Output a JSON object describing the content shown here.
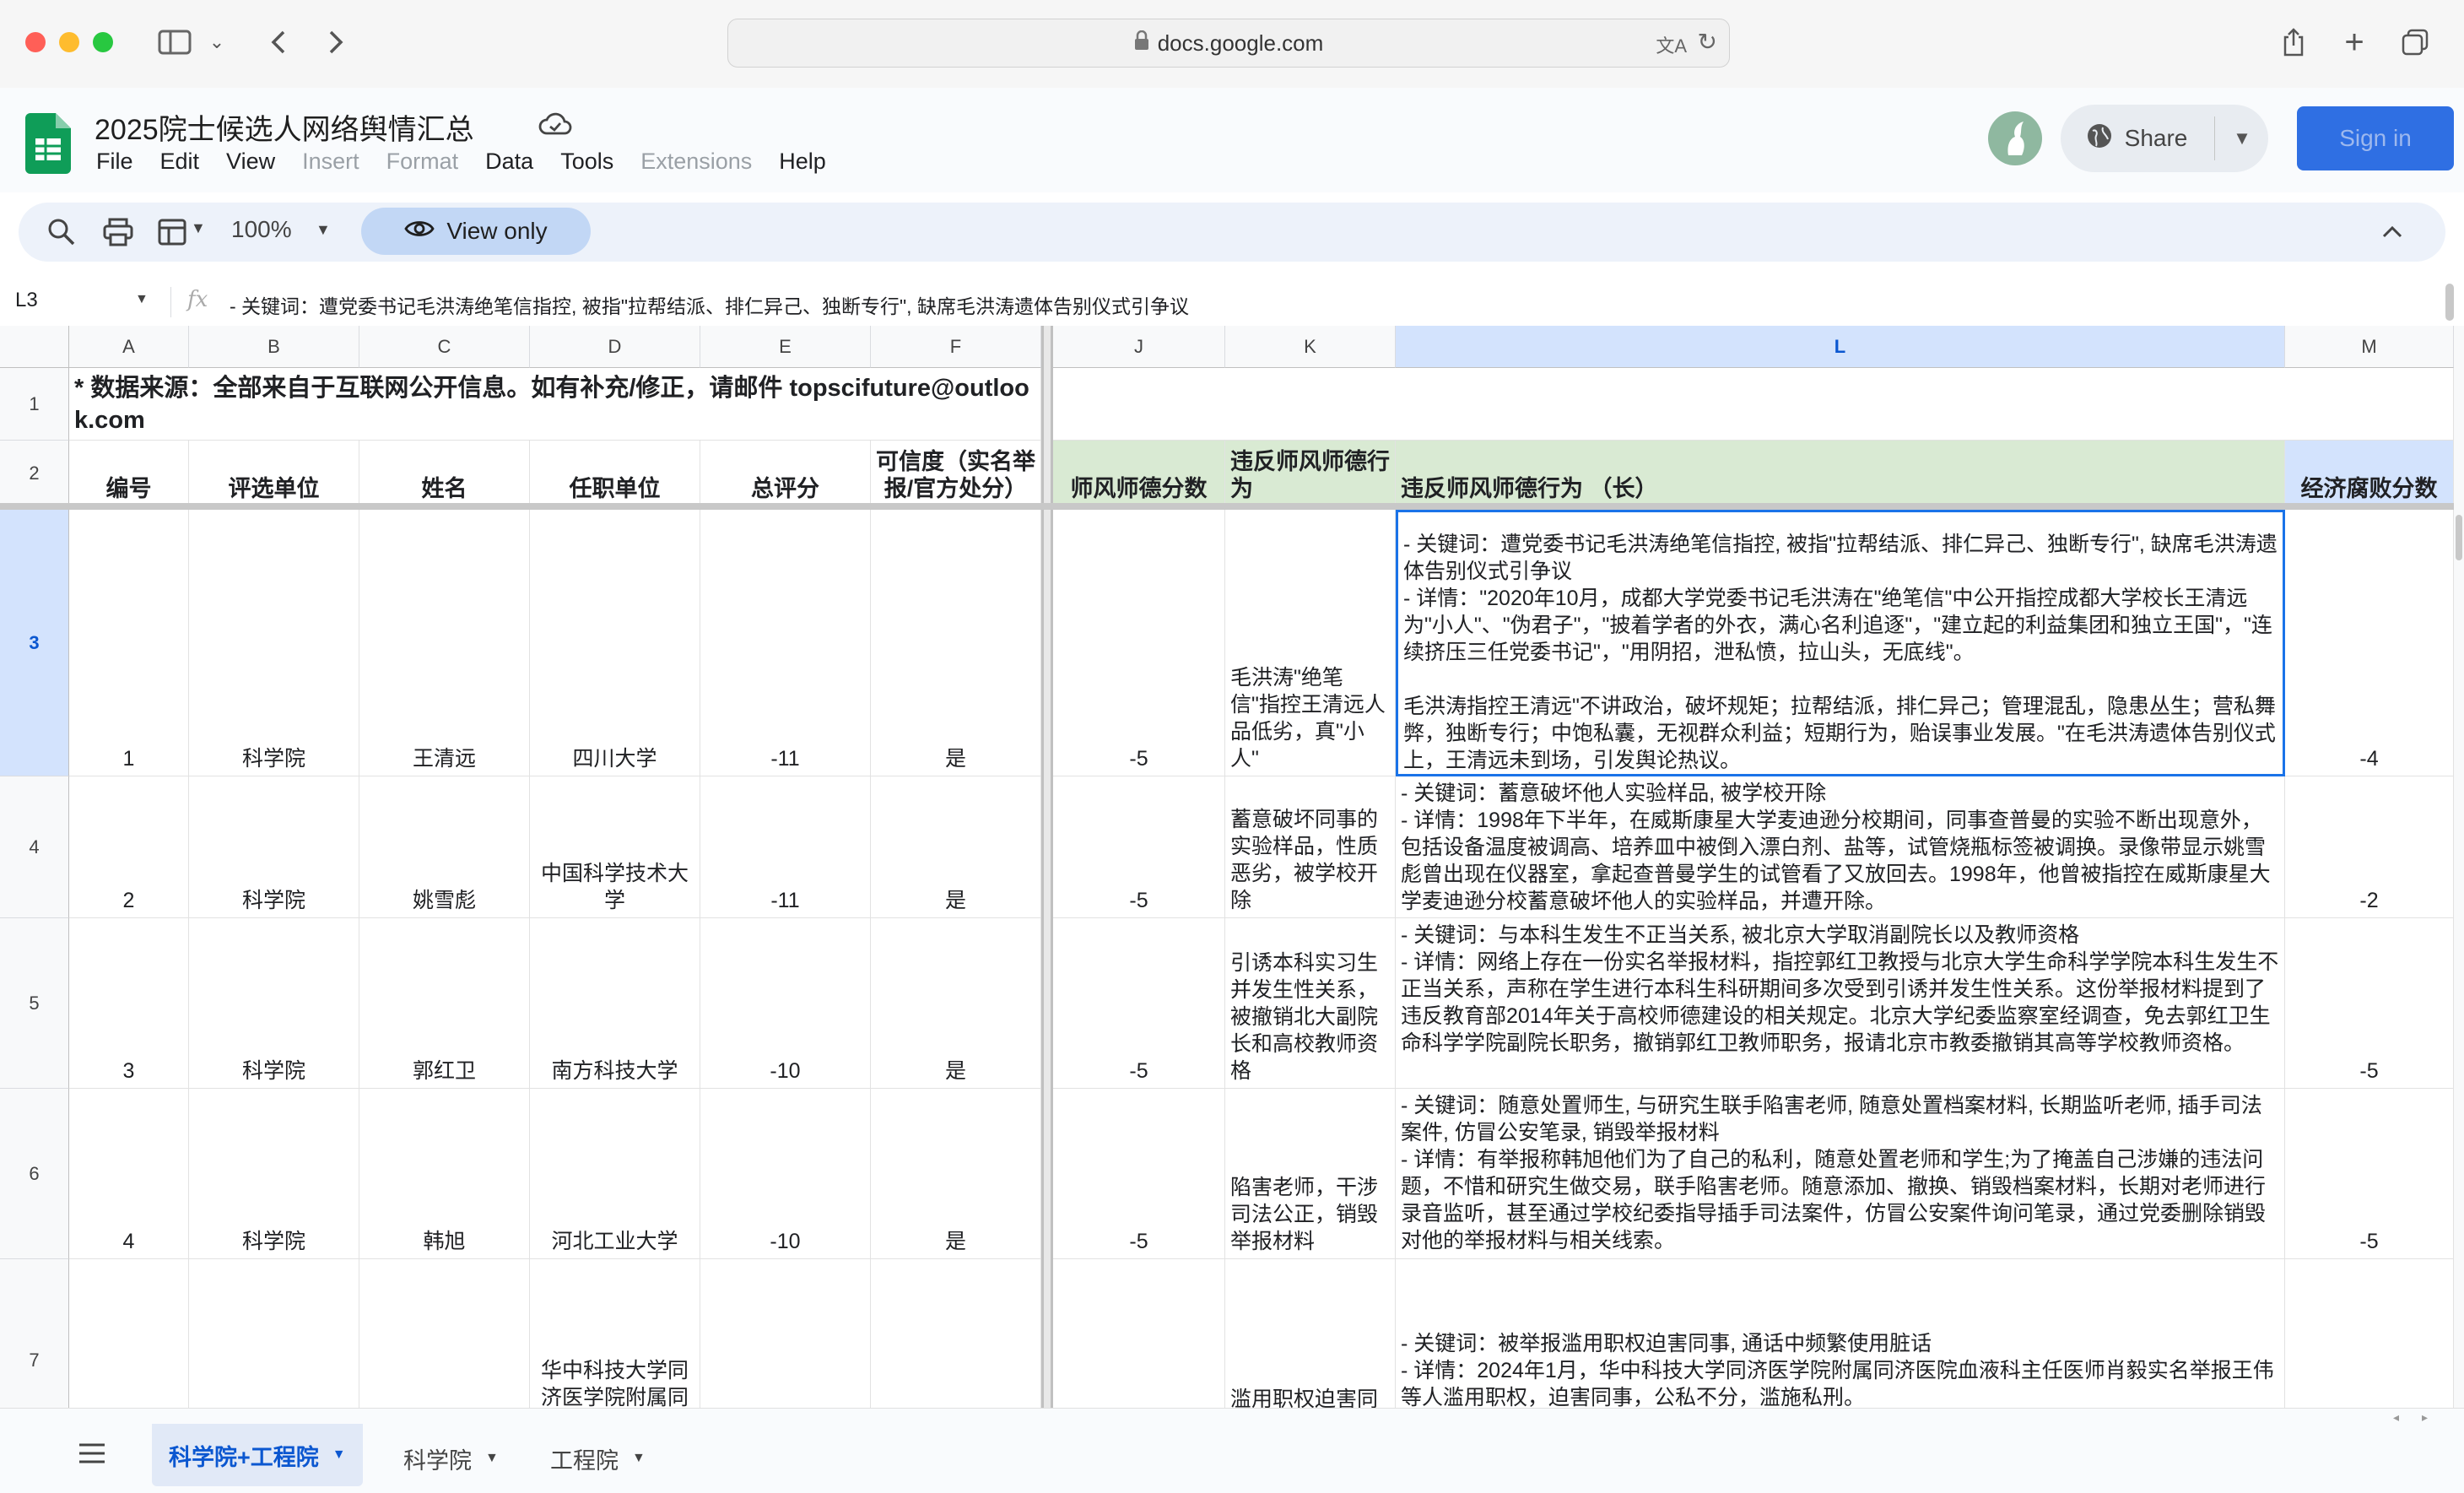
{
  "browser": {
    "url": "docs.google.com"
  },
  "doc": {
    "title": "2025院士候选人网络舆情汇总",
    "menus": [
      "File",
      "Edit",
      "View",
      "Insert",
      "Format",
      "Data",
      "Tools",
      "Extensions",
      "Help"
    ],
    "share_label": "Share",
    "signin_label": "Sign in"
  },
  "toolbar": {
    "zoom": "100%",
    "view_only_label": "View only"
  },
  "formula": {
    "cell_ref": "L3",
    "fx": "fx",
    "value": "- 关键词：遭党委书记毛洪涛绝笔信指控, 被指\"拉帮结派、排仁异己、独断专行\", 缺席毛洪涛遗体告别仪式引争议"
  },
  "grid": {
    "columns": [
      "A",
      "B",
      "C",
      "D",
      "E",
      "F",
      "J",
      "K",
      "L",
      "M"
    ],
    "rows_numbers": [
      "1",
      "2",
      "3",
      "4",
      "5",
      "6",
      "7"
    ],
    "row1_note": "* 数据来源：全部来自于互联网公开信息。如有补充/修正，请邮件 topscifuture@outlook.com",
    "headers": {
      "A": "编号",
      "B": "评选单位",
      "C": "姓名",
      "D": "任职单位",
      "E": "总评分",
      "F": "可信度（实名举报/官方处分）",
      "J": "师风师德分数",
      "K": "违反师风师德行为",
      "L": "违反师风师德行为 （长）",
      "M": "经济腐败分数"
    },
    "rows": [
      {
        "A": "1",
        "B": "科学院",
        "C": "王清远",
        "D": "四川大学",
        "E": "-11",
        "F": "是",
        "J": "-5",
        "K": "毛洪涛\"绝笔信\"指控王清远人品低劣，真\"小人\"",
        "L": "- 关键词：遭党委书记毛洪涛绝笔信指控, 被指\"拉帮结派、排仁异己、独断专行\", 缺席毛洪涛遗体告别仪式引争议\n- 详情：\"2020年10月，成都大学党委书记毛洪涛在\"绝笔信\"中公开指控成都大学校长王清远为\"小人\"、\"伪君子\"，\"披着学者的外衣，满心名利追逐\"，\"建立起的利益集团和独立王国\"，\"连续挤压三任党委书记\"，\"用阴招，泄私愤，拉山头，无底线\"。\n\n毛洪涛指控王清远\"不讲政治，破坏规矩；拉帮结派，排仁异己；管理混乱，隐患丛生；营私舞弊，独断专行；中饱私囊，无视群众利益；短期行为，贻误事业发展。\"在毛洪涛遗体告别仪式上，王清远未到场，引发舆论热议。",
        "M": "-4"
      },
      {
        "A": "2",
        "B": "科学院",
        "C": "姚雪彪",
        "D": "中国科学技术大学",
        "E": "-11",
        "F": "是",
        "J": "-5",
        "K": "蓄意破坏同事的实验样品，性质恶劣，被学校开除",
        "L": "- 关键词：蓄意破坏他人实验样品, 被学校开除\n- 详情：1998年下半年，在威斯康星大学麦迪逊分校期间，同事查普曼的实验不断出现意外，包括设备温度被调高、培养皿中被倒入漂白剂、盐等，试管烧瓶标签被调换。录像带显示姚雪彪曾出现在仪器室，拿起查普曼学生的试管看了又放回去。1998年，他曾被指控在威斯康星大学麦迪逊分校蓄意破坏他人的实验样品，并遭开除。",
        "M": "-2"
      },
      {
        "A": "3",
        "B": "科学院",
        "C": "郭红卫",
        "D": "南方科技大学",
        "E": "-10",
        "F": "是",
        "J": "-5",
        "K": "引诱本科实习生并发生性关系，被撤销北大副院长和高校教师资格",
        "L": "- 关键词：与本科生发生不正当关系, 被北京大学取消副院长以及教师资格\n- 详情：网络上存在一份实名举报材料，指控郭红卫教授与北京大学生命科学学院本科生发生不正当关系，声称在学生进行本科生科研期间多次受到引诱并发生性关系。这份举报材料提到了违反教育部2014年关于高校师德建设的相关规定。北京大学纪委监察室经调查，免去郭红卫生命科学学院副院长职务，撤销郭红卫教师职务，报请北京市教委撤销其高等学校教师资格。",
        "M": "-5"
      },
      {
        "A": "4",
        "B": "科学院",
        "C": "韩旭",
        "D": "河北工业大学",
        "E": "-10",
        "F": "是",
        "J": "-5",
        "K": "陷害老师，干涉司法公正，销毁举报材料",
        "L": "- 关键词：随意处置师生, 与研究生联手陷害老师, 随意处置档案材料, 长期监听老师, 插手司法案件, 仿冒公安笔录, 销毁举报材料\n- 详情：有举报称韩旭他们为了自己的私利，随意处置老师和学生;为了掩盖自己涉嫌的违法问题，不惜和研究生做交易，联手陷害老师。随意添加、撤换、销毁档案材料，长期对老师进行录音监听，甚至通过学校纪委指导插手司法案件，仿冒公安案件询问笔录，通过党委删除销毁对他的举报材料与相关线索。",
        "M": "-5"
      },
      {
        "A": "",
        "B": "",
        "C": "",
        "D": "华中科技大学同济医学院附属同济医院",
        "E": "",
        "F": "",
        "J": "",
        "K": "滥用职权迫害同事，通话中频繁使用脏话",
        "L": "- 关键词：被举报滥用职权迫害同事, 通话中频繁使用脏话\n- 详情：2024年1月，华中科技大学同济医学院附属同济医院血液科主任医师肖毅实名举报王伟等人滥用职权，迫害同事，公私不分，滥施私刑。",
        "M": ""
      }
    ]
  },
  "sheets": {
    "tabs": [
      "科学院+工程院",
      "科学院",
      "工程院"
    ]
  },
  "colors": {
    "accent": "#0b57d0",
    "header_green": "#d9ead3",
    "selected_header": "#d3e3fd"
  }
}
